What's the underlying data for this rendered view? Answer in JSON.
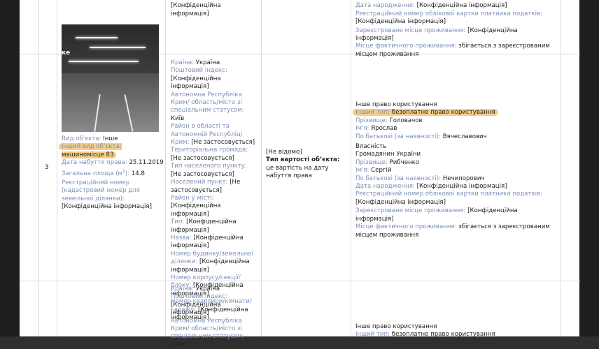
{
  "top": {
    "col2": [
      "…",
      "[Конфіденційна інформація]"
    ],
    "col4": [
      {
        "label": "…",
        "value": ""
      },
      {
        "label": "Дата народження:",
        "value": " [Конфіденційна інформація]"
      },
      {
        "label": "Реєстраційний номер облікової картки платника податків:",
        "value": " [Конфіденційна інформація]"
      },
      {
        "label": "Зареєстроване місце проживання:",
        "value": " [Конфіденційна інформація]"
      },
      {
        "label": "Місце фактичного проживання:",
        "value": " збігається з зареєстрованим місцем проживання"
      }
    ]
  },
  "row3": {
    "number": "3",
    "photo_caption": "ке",
    "object": {
      "type_label": "Вид об’єкта:",
      "type_value": " Інше",
      "other_label": "Інший вид об’єкта:",
      "other_value": " машиномісце 83",
      "date_label": "Дата набуття права:",
      "date_value": " 25.11.2019",
      "area_label": "Загальна площа (м",
      "area_sup": "2",
      "area_suffix": "):",
      "area_value": " 14.8",
      "cad_label": "Реєстраційний номер (кадастровий номер для земельної ділянки):",
      "cad_value": "[Конфіденційна інформація]"
    },
    "address": [
      {
        "label": "Країна:",
        "value": " Україна"
      },
      {
        "label": "Поштовий індекс:",
        "value": " [Конфіденційна інформація]"
      },
      {
        "label": "Автономна Республіка Крим/ область/місто зі спеціальним статусом:",
        "value": " Київ"
      },
      {
        "label": "Район в області та Автономній Республіці Крим:",
        "value": " [Не застосовується]"
      },
      {
        "label": "Територіальна громада:",
        "value": " [Не застосовується]"
      },
      {
        "label": "Тип населеного пункту:",
        "value": " [Не застосовується]"
      },
      {
        "label": "Населений пункт:",
        "value": " [Не застосовується]"
      },
      {
        "label": "Район у місті:",
        "value": " [Конфіденційна інформація]"
      },
      {
        "label": "Тип:",
        "value": " [Конфіденційна інформація]"
      },
      {
        "label": "Назва:",
        "value": " [Конфіденційна інформація]"
      },
      {
        "label": "Номер будинку/земельної ділянки:",
        "value": " [Конфіденційна інформація]"
      },
      {
        "label": "Номер корпусу/секції/блоку:",
        "value": " [Конфіденційна інформація]"
      },
      {
        "label": "Номер квартири/кімнати/гаражу:",
        "value": " [Конфіденційна інформація]"
      }
    ],
    "value_cell": {
      "unknown": "[Не відомо]",
      "type_label": "Тип вартості об’єкта:",
      "type_value": " це вартість на дату набуття права"
    },
    "rights": {
      "r1_title": "Інше право користування",
      "r1_other_label": "Інший тип:",
      "r1_other_value": " безоплатне право користування",
      "r1_surname_label": "Прізвище:",
      "r1_surname_value": " Головачов",
      "r1_name_label": "Ім'я:",
      "r1_name_value": " Ярослав",
      "r1_patr_label": "По батькові (за наявності):",
      "r1_patr_value": " Вячеславович",
      "r2_title": "Власність",
      "r2_citizen": "Громадянин України",
      "r2_surname_label": "Прізвище:",
      "r2_surname_value": " Рибченко",
      "r2_name_label": "Ім'я:",
      "r2_name_value": " Сергій",
      "r2_patr_label": "По батькові (за наявності):",
      "r2_patr_value": " Нечипорович",
      "r2_dob_label": "Дата народження:",
      "r2_dob_value": " [Конфіденційна інформація]",
      "r2_tax_label": "Реєстраційний номер облікової картки платника податків:",
      "r2_tax_value": " [Конфіденційна інформація]",
      "r2_reg_label": "Зареєстроване місце проживання:",
      "r2_reg_value": " [Конфіденційна інформація]",
      "r2_fact_label": "Місце фактичного проживання:",
      "r2_fact_value": " збігається з зареєстрованим місцем проживання"
    }
  },
  "row4": {
    "address": [
      {
        "label": "Країна:",
        "value": " Україна"
      },
      {
        "label": "Поштовий індекс:",
        "value": " [Конфіденційна інформація]"
      },
      {
        "label": "Автономна Республіка Крим/ область/місто зі спеціальним статусом:",
        "value": " Київ"
      }
    ],
    "rights": {
      "r1_title": "Інше право користування",
      "r1_other_label": "Інший тип:",
      "r1_other_value": " безоплатне право користування"
    }
  }
}
